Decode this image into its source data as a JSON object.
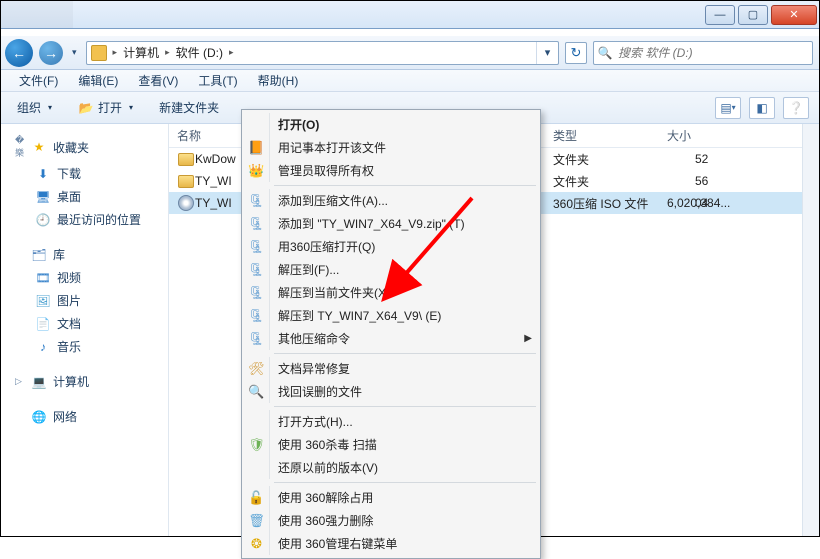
{
  "titlebar": {
    "min_glyph": "—",
    "max_glyph": "▢",
    "close_glyph": "✕"
  },
  "nav": {
    "back_glyph": "←",
    "fwd_glyph": "→",
    "drop_glyph": "▾",
    "addr_seg1": "计算机",
    "addr_seg2": "软件 (D:)",
    "addr_drop": "▾",
    "refresh_glyph": "↻",
    "search_placeholder": "搜索 软件 (D:)"
  },
  "menu": {
    "file": "文件(F)",
    "edit": "编辑(E)",
    "view": "查看(V)",
    "tools": "工具(T)",
    "help": "帮助(H)"
  },
  "toolbar": {
    "organize": "组织",
    "open": "打开",
    "newfolder": "新建文件夹",
    "drop_glyph": "▾"
  },
  "columns": {
    "name": "名称",
    "type": "类型",
    "size": "大小"
  },
  "sidebar": {
    "fav": "收藏夹",
    "fav_items": [
      "下载",
      "桌面",
      "最近访问的位置"
    ],
    "lib": "库",
    "lib_items": [
      "视频",
      "图片",
      "文档",
      "音乐"
    ],
    "computer": "计算机",
    "network": "网络"
  },
  "rows": [
    {
      "name": "KwDow",
      "date_frag": "52",
      "type": "文件夹",
      "size": ""
    },
    {
      "name": "TY_WI",
      "date_frag": "56",
      "type": "文件夹",
      "size": ""
    },
    {
      "name": "TY_WI",
      "date_frag": "04",
      "type": "360压缩 ISO 文件",
      "size": "6,020,384..."
    }
  ],
  "ctx": {
    "open": "打开(O)",
    "notepad": "用记事本打开该文件",
    "admin": "管理员取得所有权",
    "addarchive": "添加到压缩文件(A)...",
    "addzip": "添加到 \"TY_WIN7_X64_V9.zip\" (T)",
    "open360": "用360压缩打开(Q)",
    "extractto": "解压到(F)...",
    "extracthere": "解压到当前文件夹(X)",
    "extractname": "解压到 TY_WIN7_X64_V9\\ (E)",
    "othercomp": "其他压缩命令",
    "docrepair": "文档异常修复",
    "undelete": "找回误删的文件",
    "openwith": "打开方式(H)...",
    "scan360": "使用 360杀毒 扫描",
    "restore": "还原以前的版本(V)",
    "unlock360": "使用 360解除占用",
    "forcedel360": "使用 360强力删除",
    "mgr360": "使用 360管理右键菜单",
    "sub_glyph": "▶"
  }
}
